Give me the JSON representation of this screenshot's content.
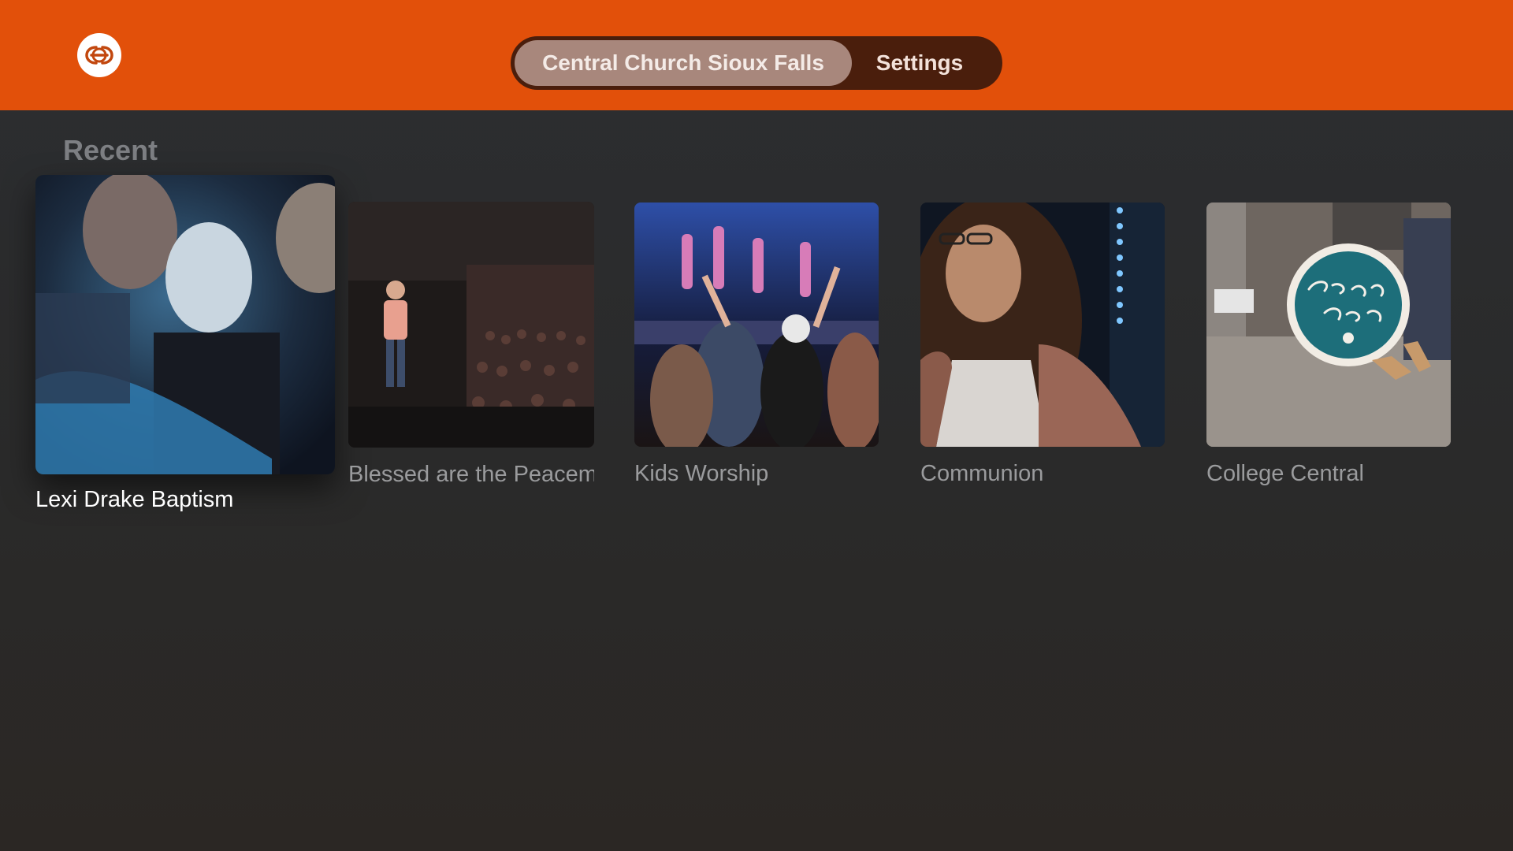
{
  "header": {
    "logo": "central-church-logo",
    "tabs": [
      {
        "label": "Central Church Sioux Falls",
        "selected": true
      },
      {
        "label": "Settings",
        "selected": false
      }
    ],
    "accent_color": "#e2500a"
  },
  "main": {
    "section_title": "Recent",
    "items": [
      {
        "title": "Lexi Drake Baptism",
        "focused": true
      },
      {
        "title": "Blessed are the Peacemakers",
        "focused": false
      },
      {
        "title": "Kids Worship",
        "focused": false
      },
      {
        "title": "Communion",
        "focused": false
      },
      {
        "title": "College Central",
        "focused": false
      }
    ]
  }
}
